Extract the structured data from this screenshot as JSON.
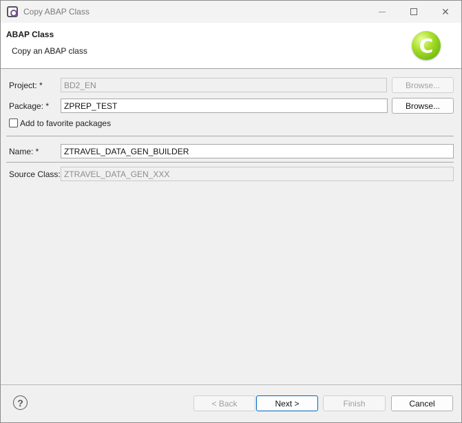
{
  "window": {
    "title": "Copy ABAP Class"
  },
  "banner": {
    "title": "ABAP Class",
    "description": "Copy an ABAP class",
    "icon_letter": "C"
  },
  "icons": {
    "app": "eclipse-app-icon",
    "class": "abap-class-icon",
    "help": "help-icon"
  },
  "form": {
    "project_label": "Project: *",
    "project_value": "BD2_EN",
    "project_browse": "Browse...",
    "package_label": "Package: *",
    "package_value": "ZPREP_TEST",
    "package_browse": "Browse...",
    "favorite_label": "Add to favorite packages",
    "favorite_checked": false,
    "name_label": "Name: *",
    "name_value": "ZTRAVEL_DATA_GEN_BUILDER",
    "source_label": "Source Class:",
    "source_value": "ZTRAVEL_DATA_GEN_XXX"
  },
  "footer": {
    "help": "?",
    "back": "< Back",
    "next": "Next >",
    "finish": "Finish",
    "cancel": "Cancel"
  }
}
